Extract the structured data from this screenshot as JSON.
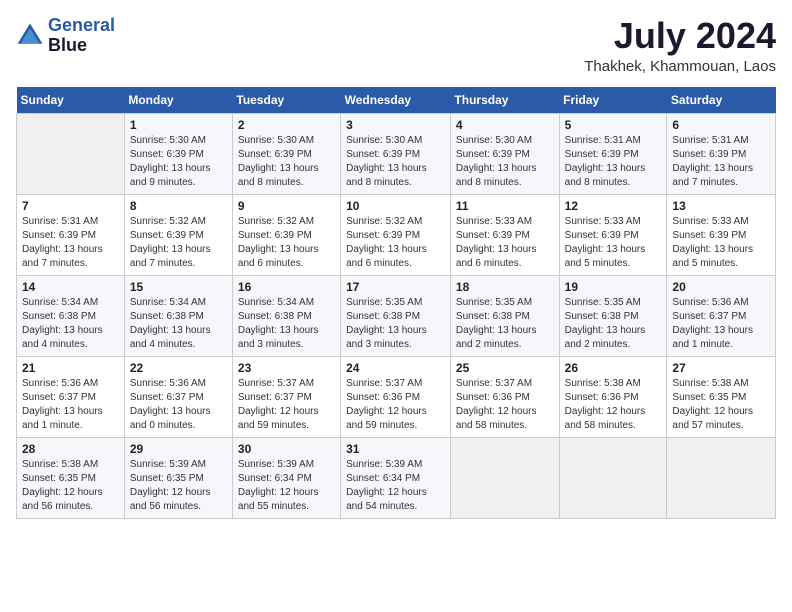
{
  "header": {
    "logo_line1": "General",
    "logo_line2": "Blue",
    "month_year": "July 2024",
    "location": "Thakhek, Khammouan, Laos"
  },
  "weekdays": [
    "Sunday",
    "Monday",
    "Tuesday",
    "Wednesday",
    "Thursday",
    "Friday",
    "Saturday"
  ],
  "weeks": [
    [
      {
        "day": "",
        "empty": true
      },
      {
        "day": "1",
        "sunrise": "5:30 AM",
        "sunset": "6:39 PM",
        "daylight": "13 hours and 9 minutes."
      },
      {
        "day": "2",
        "sunrise": "5:30 AM",
        "sunset": "6:39 PM",
        "daylight": "13 hours and 8 minutes."
      },
      {
        "day": "3",
        "sunrise": "5:30 AM",
        "sunset": "6:39 PM",
        "daylight": "13 hours and 8 minutes."
      },
      {
        "day": "4",
        "sunrise": "5:30 AM",
        "sunset": "6:39 PM",
        "daylight": "13 hours and 8 minutes."
      },
      {
        "day": "5",
        "sunrise": "5:31 AM",
        "sunset": "6:39 PM",
        "daylight": "13 hours and 8 minutes."
      },
      {
        "day": "6",
        "sunrise": "5:31 AM",
        "sunset": "6:39 PM",
        "daylight": "13 hours and 7 minutes."
      }
    ],
    [
      {
        "day": "7",
        "sunrise": "5:31 AM",
        "sunset": "6:39 PM",
        "daylight": "13 hours and 7 minutes."
      },
      {
        "day": "8",
        "sunrise": "5:32 AM",
        "sunset": "6:39 PM",
        "daylight": "13 hours and 7 minutes."
      },
      {
        "day": "9",
        "sunrise": "5:32 AM",
        "sunset": "6:39 PM",
        "daylight": "13 hours and 6 minutes."
      },
      {
        "day": "10",
        "sunrise": "5:32 AM",
        "sunset": "6:39 PM",
        "daylight": "13 hours and 6 minutes."
      },
      {
        "day": "11",
        "sunrise": "5:33 AM",
        "sunset": "6:39 PM",
        "daylight": "13 hours and 6 minutes."
      },
      {
        "day": "12",
        "sunrise": "5:33 AM",
        "sunset": "6:39 PM",
        "daylight": "13 hours and 5 minutes."
      },
      {
        "day": "13",
        "sunrise": "5:33 AM",
        "sunset": "6:39 PM",
        "daylight": "13 hours and 5 minutes."
      }
    ],
    [
      {
        "day": "14",
        "sunrise": "5:34 AM",
        "sunset": "6:38 PM",
        "daylight": "13 hours and 4 minutes."
      },
      {
        "day": "15",
        "sunrise": "5:34 AM",
        "sunset": "6:38 PM",
        "daylight": "13 hours and 4 minutes."
      },
      {
        "day": "16",
        "sunrise": "5:34 AM",
        "sunset": "6:38 PM",
        "daylight": "13 hours and 3 minutes."
      },
      {
        "day": "17",
        "sunrise": "5:35 AM",
        "sunset": "6:38 PM",
        "daylight": "13 hours and 3 minutes."
      },
      {
        "day": "18",
        "sunrise": "5:35 AM",
        "sunset": "6:38 PM",
        "daylight": "13 hours and 2 minutes."
      },
      {
        "day": "19",
        "sunrise": "5:35 AM",
        "sunset": "6:38 PM",
        "daylight": "13 hours and 2 minutes."
      },
      {
        "day": "20",
        "sunrise": "5:36 AM",
        "sunset": "6:37 PM",
        "daylight": "13 hours and 1 minute."
      }
    ],
    [
      {
        "day": "21",
        "sunrise": "5:36 AM",
        "sunset": "6:37 PM",
        "daylight": "13 hours and 1 minute."
      },
      {
        "day": "22",
        "sunrise": "5:36 AM",
        "sunset": "6:37 PM",
        "daylight": "13 hours and 0 minutes."
      },
      {
        "day": "23",
        "sunrise": "5:37 AM",
        "sunset": "6:37 PM",
        "daylight": "12 hours and 59 minutes."
      },
      {
        "day": "24",
        "sunrise": "5:37 AM",
        "sunset": "6:36 PM",
        "daylight": "12 hours and 59 minutes."
      },
      {
        "day": "25",
        "sunrise": "5:37 AM",
        "sunset": "6:36 PM",
        "daylight": "12 hours and 58 minutes."
      },
      {
        "day": "26",
        "sunrise": "5:38 AM",
        "sunset": "6:36 PM",
        "daylight": "12 hours and 58 minutes."
      },
      {
        "day": "27",
        "sunrise": "5:38 AM",
        "sunset": "6:35 PM",
        "daylight": "12 hours and 57 minutes."
      }
    ],
    [
      {
        "day": "28",
        "sunrise": "5:38 AM",
        "sunset": "6:35 PM",
        "daylight": "12 hours and 56 minutes."
      },
      {
        "day": "29",
        "sunrise": "5:39 AM",
        "sunset": "6:35 PM",
        "daylight": "12 hours and 56 minutes."
      },
      {
        "day": "30",
        "sunrise": "5:39 AM",
        "sunset": "6:34 PM",
        "daylight": "12 hours and 55 minutes."
      },
      {
        "day": "31",
        "sunrise": "5:39 AM",
        "sunset": "6:34 PM",
        "daylight": "12 hours and 54 minutes."
      },
      {
        "day": "",
        "empty": true
      },
      {
        "day": "",
        "empty": true
      },
      {
        "day": "",
        "empty": true
      }
    ]
  ]
}
